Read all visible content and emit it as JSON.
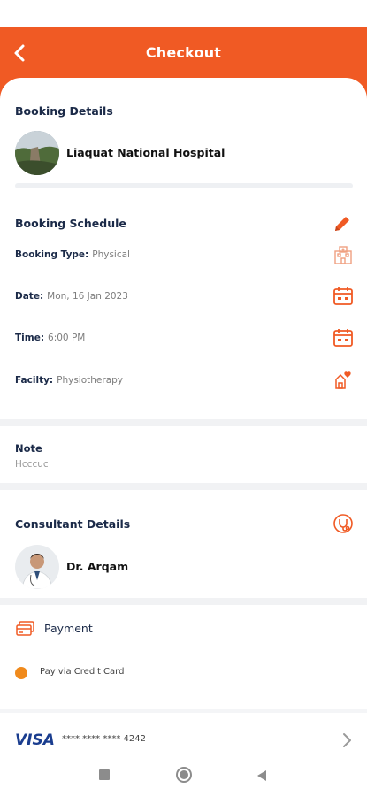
{
  "header": {
    "title": "Checkout",
    "back_icon": "chevron-left-icon"
  },
  "booking_details": {
    "title": "Booking Details",
    "hospital_name": "Liaquat National Hospital"
  },
  "booking_schedule": {
    "title": "Booking Schedule",
    "rows": [
      {
        "label": "Booking Type:",
        "value": "Physical",
        "icon": "hospital-icon"
      },
      {
        "label": "Date:",
        "value": "Mon, 16 Jan 2023",
        "icon": "calendar-icon"
      },
      {
        "label": "Time:",
        "value": "6:00 PM",
        "icon": "calendar-icon"
      },
      {
        "label": "Facilty:",
        "value": "Physiotherapy",
        "icon": "physiotherapy-icon"
      }
    ],
    "edit_icon": "pencil-icon"
  },
  "note": {
    "title": "Note",
    "text": "Hcccuc"
  },
  "consultant": {
    "title": "Consultant Details",
    "name": "Dr. Arqam",
    "icon": "stethoscope-icon"
  },
  "payment": {
    "title": "Payment",
    "option": "Pay via Credit Card",
    "card_brand": "VISA",
    "card_number": "**** **** **** 4242"
  },
  "colors": {
    "accent": "#f05a24",
    "radio": "#f08a1c",
    "heading": "#1b2a48"
  }
}
